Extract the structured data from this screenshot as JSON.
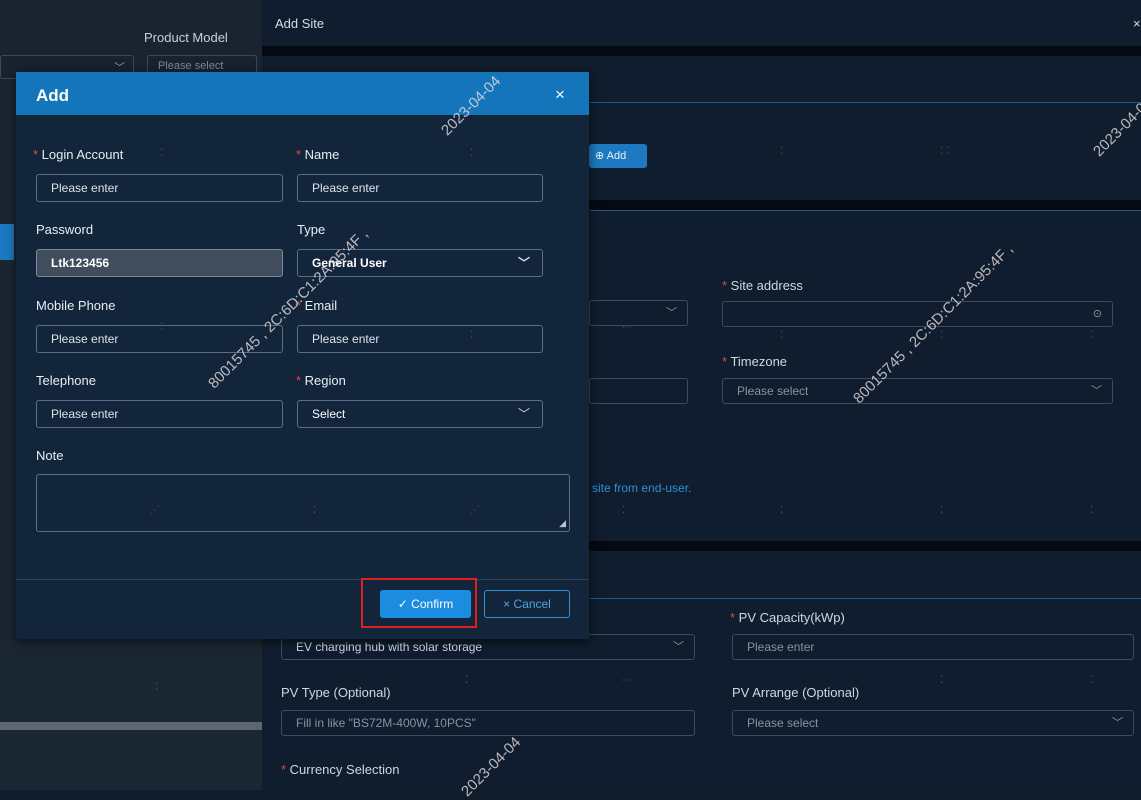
{
  "background": {
    "product_model_label": "Product Model",
    "product_model_placeholder": "Please select"
  },
  "drawer": {
    "title": "Add Site",
    "close": "×",
    "add_button": "⊕ Add",
    "site_address_label": "Site address",
    "timezone_label": "Timezone",
    "timezone_placeholder": "Please select",
    "end_user_link": "site from end-user.",
    "pv_capacity_label": "PV Capacity(kWp)",
    "pv_capacity_placeholder": "Please enter",
    "site_type_value": "EV charging hub with solar storage",
    "pv_type_label": "PV Type (Optional)",
    "pv_type_placeholder": "Fill in like \"BS72M-400W, 10PCS\"",
    "pv_arrange_label": "PV Arrange (Optional)",
    "pv_arrange_placeholder": "Please select",
    "currency_label": "Currency Selection"
  },
  "modal": {
    "title": "Add",
    "close": "×",
    "login_account_label": "Login Account",
    "login_account_placeholder": "Please enter",
    "name_label": "Name",
    "name_placeholder": "Please enter",
    "password_label": "Password",
    "password_value": "Ltk123456",
    "type_label": "Type",
    "type_value": "General User",
    "mobile_label": "Mobile Phone",
    "mobile_placeholder": "Please enter",
    "email_label": "Email",
    "email_placeholder": "Please enter",
    "telephone_label": "Telephone",
    "telephone_placeholder": "Please enter",
    "region_label": "Region",
    "region_value": "Select",
    "note_label": "Note",
    "confirm_label": "✓ Confirm",
    "cancel_label": "× Cancel"
  },
  "watermarks": {
    "date": "2023-04-04",
    "id": "80015745 , 2C:6D:C1:2A:95:4F ,",
    "id_short": "80015745 , 2C:6D:C1:2A:95:4F"
  },
  "colors": {
    "accent": "#1575ba",
    "required": "#e04a4a",
    "highlight": "#e02020"
  }
}
